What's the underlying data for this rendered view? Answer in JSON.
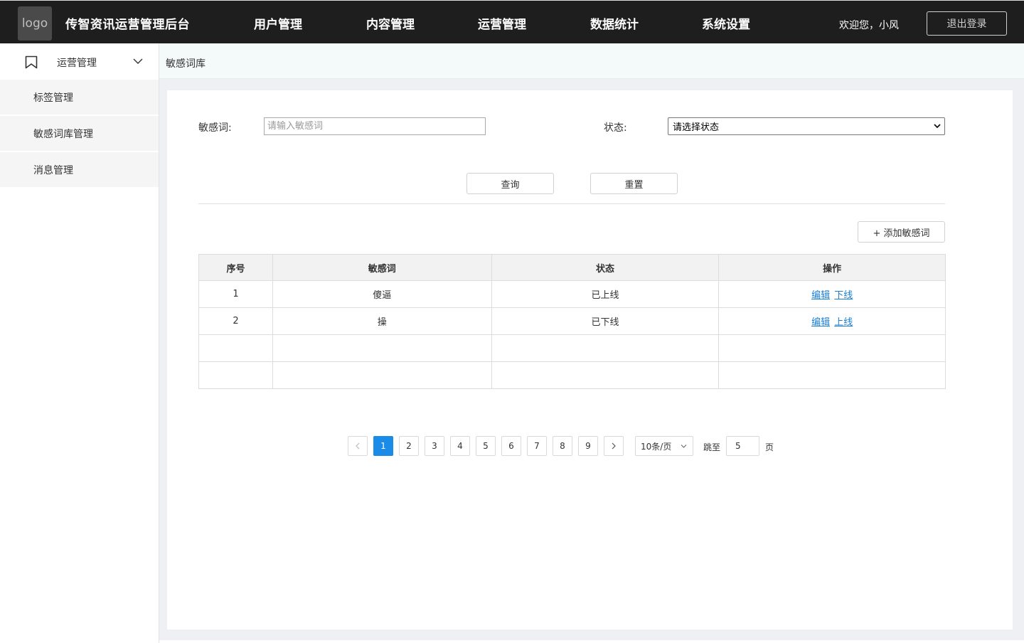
{
  "header": {
    "logo_text": "logo",
    "app_title": "传智资讯运营管理后台",
    "nav": [
      "用户管理",
      "内容管理",
      "运营管理",
      "数据统计",
      "系统设置"
    ],
    "welcome": "欢迎您，小风",
    "logout_label": "退出登录"
  },
  "sidebar": {
    "section_label": "运营管理",
    "items": [
      "标签管理",
      "敏感词库管理",
      "消息管理"
    ]
  },
  "breadcrumb": "敏感词库",
  "filters": {
    "word_label": "敏感词:",
    "word_placeholder": "请输入敏感词",
    "status_label": "状态:",
    "status_selected": "请选择状态",
    "query_label": "查询",
    "reset_label": "重置"
  },
  "add_label": "+ 添加敏感词",
  "table": {
    "headers": [
      "序号",
      "敏感词",
      "状态",
      "操作"
    ],
    "rows": [
      {
        "index": "1",
        "word": "傻逼",
        "status": "已上线",
        "edit": "编辑",
        "toggle": "下线"
      },
      {
        "index": "2",
        "word": "操",
        "status": "已下线",
        "edit": "编辑",
        "toggle": "上线"
      }
    ]
  },
  "pagination": {
    "pages": [
      "1",
      "2",
      "3",
      "4",
      "5",
      "6",
      "7",
      "8",
      "9"
    ],
    "current": "1",
    "page_size": "10条/页",
    "jump_label": "跳至",
    "jump_value": "5",
    "jump_unit": "页"
  },
  "colors": {
    "topbar": "#1e1e1e",
    "accent": "#1a8be6",
    "link": "#1a7fd4"
  }
}
